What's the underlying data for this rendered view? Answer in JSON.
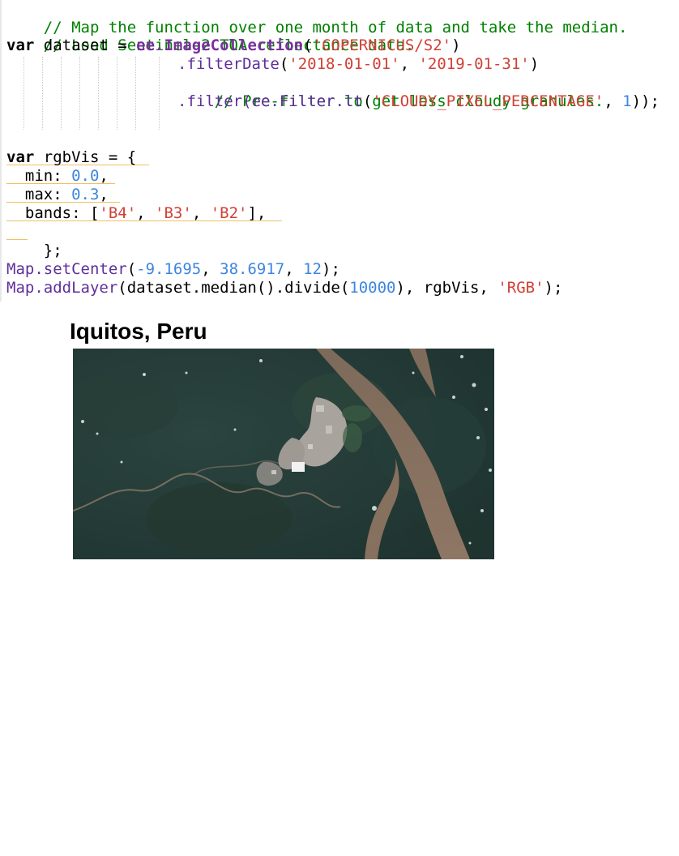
{
  "code": {
    "line1_comment": "// Map the function over one month of data and take the median.",
    "line2_comment": "// Load Sentinel-2 TOA reflectance data.",
    "line3": {
      "kw": "var",
      "name": " dataset = ",
      "ee": "ee.ImageCollection",
      "open": "(",
      "str": "'COPERNICUS/S2'",
      "close": ")"
    },
    "line4": {
      "method": ".filterDate",
      "open": "(",
      "str1": "'2018-01-01'",
      "sep": ", ",
      "str2": "'2019-01-31'",
      "close": ")"
    },
    "line5_comment": "// Pre-filter to get less cloudy granules.",
    "line6": {
      "method": ".filter",
      "open": "(ee.",
      "filter_cls": "Filter",
      "lt": ".lt",
      "open2": "(",
      "str": "'CLOUDY_PIXEL_PERCENTAGE'",
      "sep": ", ",
      "num": "1",
      "close": "));"
    },
    "line8": {
      "kw": "var",
      "rest": " rgbVis = {"
    },
    "line9": {
      "key": "  min: ",
      "num": "0.0",
      "tail": ","
    },
    "line10": {
      "key": "  max: ",
      "num": "0.3",
      "tail": ","
    },
    "line11": {
      "key": "  bands: [",
      "b1": "'B4'",
      "sep1": ", ",
      "b2": "'B3'",
      "sep2": ", ",
      "b3": "'B2'",
      "tail": "],"
    },
    "line12": "};",
    "line14": {
      "obj": "Map.setCenter",
      "open": "(",
      "n1": "-9.1695",
      "sep1": ", ",
      "n2": "38.6917",
      "sep2": ", ",
      "n3": "12",
      "close": ");"
    },
    "line15": {
      "obj": "Map.addLayer",
      "mid1": "(dataset.median().divide(",
      "num": "10000",
      "mid2": "), rgbVis, ",
      "str": "'RGB'",
      "close": ");"
    }
  },
  "map": {
    "title": "Iquitos, Peru"
  },
  "colors": {
    "comment": "#008000",
    "string": "#d14036",
    "number": "#3d85e0",
    "method": "#5f2f9a",
    "forest": "#243a35",
    "river": "#8a7260",
    "urban": "#b7b2ad",
    "underline": "#f0c060"
  }
}
